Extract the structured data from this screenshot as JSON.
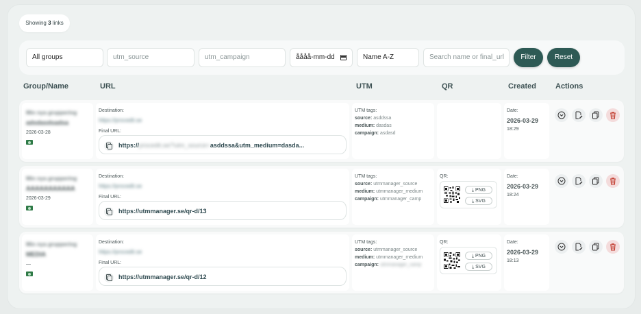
{
  "summary": {
    "prefix": "Showing",
    "count": "3",
    "suffix": "links"
  },
  "filters": {
    "group": "All groups",
    "utm_source_placeholder": "utm_source",
    "utm_campaign_placeholder": "utm_campaign",
    "date_placeholder": "åååå-mm-dd",
    "sort": "Name A-Z",
    "search_placeholder": "Search name or final_url",
    "filter_label": "Filter",
    "reset_label": "Reset"
  },
  "columns": {
    "group_name": "Group/Name",
    "url": "URL",
    "utm": "UTM",
    "qr": "QR",
    "created": "Created",
    "actions": "Actions"
  },
  "labels": {
    "destination": "Destination:",
    "final_url": "Final URL:",
    "utm_tags": "UTM tags:",
    "qr": "QR:",
    "date": "Date:",
    "source": "source:",
    "medium": "medium:",
    "campaign": "campaign:",
    "png": "PNG",
    "svg": "SVG"
  },
  "rows": [
    {
      "group": "Min nya gruppering",
      "name": "adsdasdsadsa",
      "date": "2026-03-28",
      "destination": "https://procedit.se",
      "final_url_prefix": "https://",
      "final_url_blurred": "procedit.se/?utm_source=",
      "final_url_rest": "asddssa&utm_medium=dasda...",
      "utm_source": "asddssa",
      "utm_medium": "dasdas",
      "utm_campaign": "asdasd",
      "created_date": "2026-03-29",
      "created_time": "18:29"
    },
    {
      "group": "Min nya gruppering",
      "name": "AAAAAAAAAAA",
      "date": "2026-03-29",
      "destination": "https://procedit.se",
      "final_url": "https://utmmanager.se/qr-d/13",
      "utm_source": "utmmanager_source",
      "utm_medium": "utmmanager_medium",
      "utm_campaign": "utmmanager_camp",
      "created_date": "2026-03-29",
      "created_time": "18:24"
    },
    {
      "group": "Min nya gruppering",
      "name": "MEDIA",
      "date": "—",
      "destination": "https://procedit.se",
      "final_url": "https://utmmanager.se/qr-d/12",
      "utm_source": "utmmanager_source",
      "utm_medium": "utmmanager_medium",
      "utm_campaign": "utmmanager_camp",
      "created_date": "2026-03-29",
      "created_time": "18:13"
    }
  ],
  "colors": {
    "accent": "#2e5a55",
    "delete_bg": "#f4dcdc",
    "delete_icon": "#c0392b",
    "money_icon": "#2f7a47"
  },
  "icons": [
    "copy-icon",
    "chevron-down-icon",
    "edit-icon",
    "duplicate-icon",
    "trash-icon",
    "download-icon",
    "money-icon",
    "calendar-icon",
    "qr-code-icon"
  ]
}
